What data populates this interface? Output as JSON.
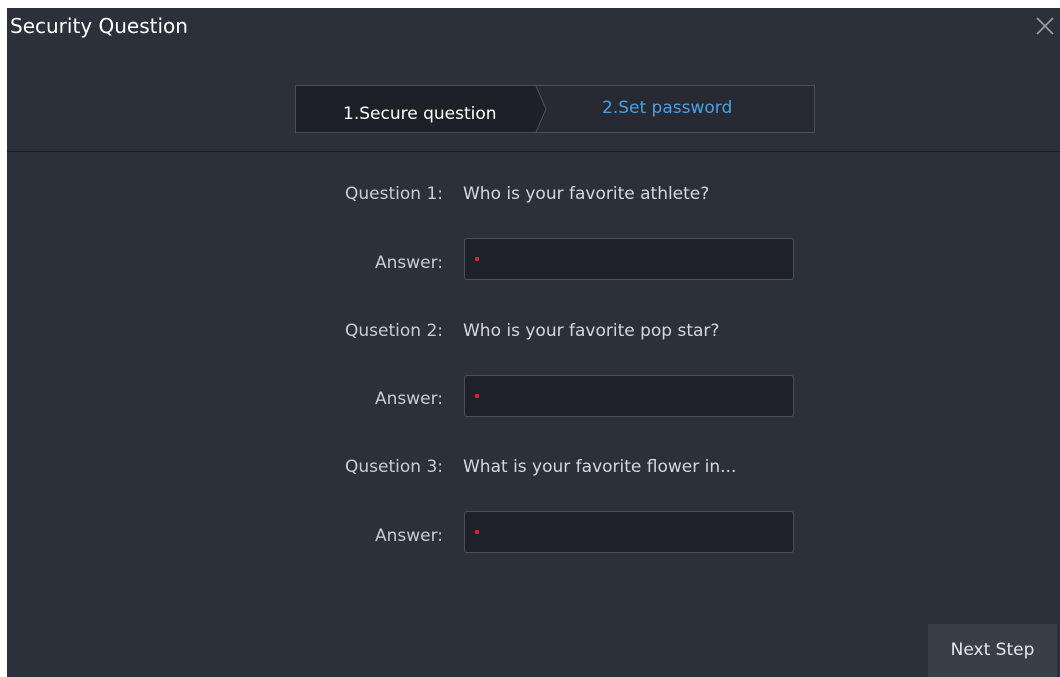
{
  "dialog": {
    "title": "Security Question",
    "close_icon": "close-icon"
  },
  "steps": [
    {
      "label": "1.Secure question",
      "state": "current"
    },
    {
      "label": "2.Set password",
      "state": "next",
      "color": "#4aa0e6"
    }
  ],
  "questions": [
    {
      "label": "Question 1:",
      "text": "Who is your favorite athlete?",
      "answer_label": "Answer:",
      "answer_value": ""
    },
    {
      "label": "Qusetion 2:",
      "text": "Who is your favorite pop star?",
      "answer_label": "Answer:",
      "answer_value": ""
    },
    {
      "label": "Qusetion 3:",
      "text": "What is your favorite flower in...",
      "answer_label": "Answer:",
      "answer_value": ""
    }
  ],
  "buttons": {
    "next": "Next Step"
  },
  "colors": {
    "background": "#2c303b",
    "accent": "#4aa0e6",
    "required": "#e0202a"
  }
}
